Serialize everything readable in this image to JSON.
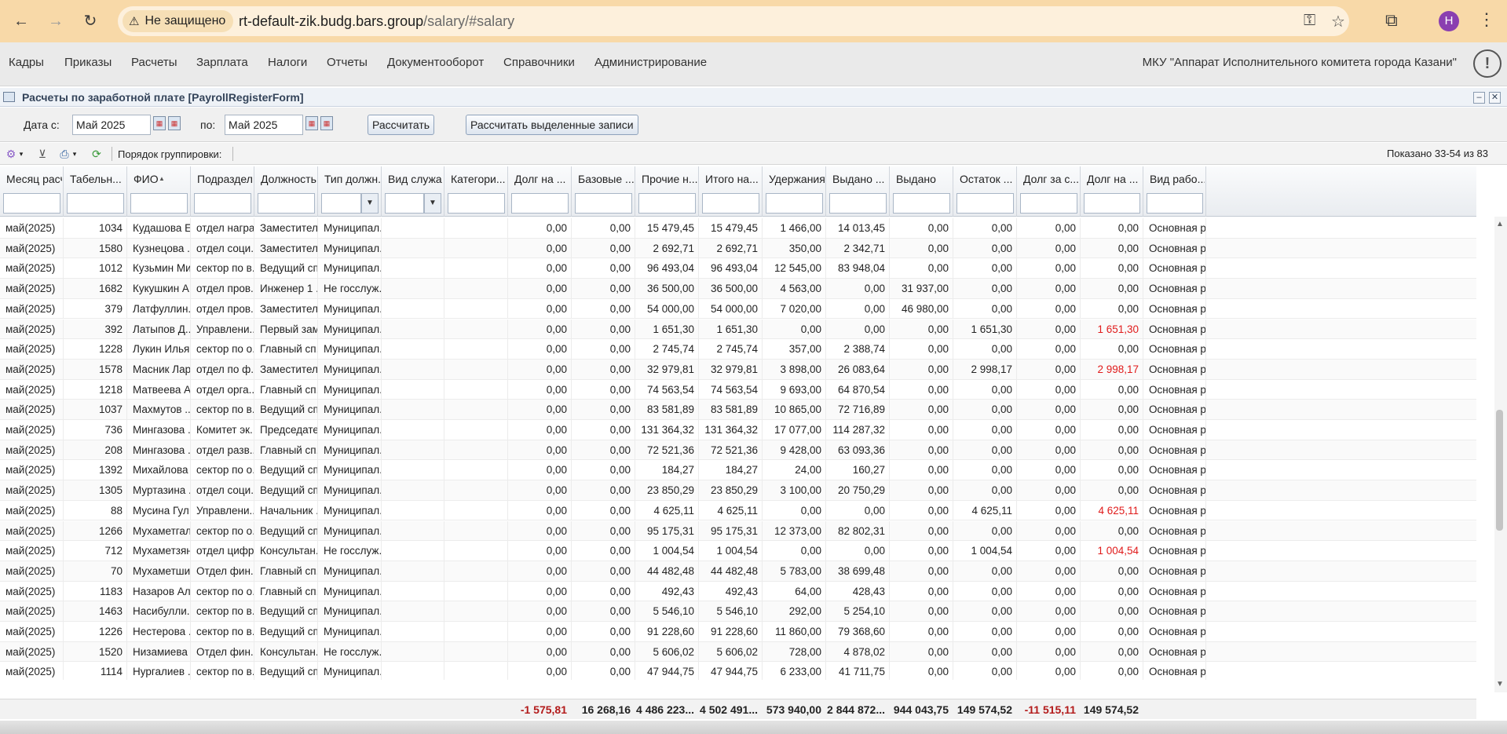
{
  "browser": {
    "not_secure_label": "Не защищено",
    "url_host": "rt-default-zik.budg.bars.group",
    "url_path": "/salary/#salary",
    "profile_initial": "Н"
  },
  "menu": {
    "items": [
      "Кадры",
      "Приказы",
      "Расчеты",
      "Зарплата",
      "Налоги",
      "Отчеты",
      "Документооборот",
      "Справочники",
      "Администрирование"
    ],
    "org": "МКУ \"Аппарат Исполнительного комитета города Казани\""
  },
  "form": {
    "title": "Расчеты по заработной плате [PayrollRegisterForm]",
    "date_from_label": "Дата с:",
    "date_from": "Май 2025",
    "date_to_label": "по:",
    "date_to": "Май 2025",
    "calc_button": "Рассчитать",
    "calc_selected_button": "Рассчитать выделенные записи"
  },
  "toolbar": {
    "group_label": "Порядок группировки:",
    "shown": "Показано 33-54 из 83"
  },
  "columns": [
    "Месяц расч...",
    "Табельн...",
    "ФИО",
    "Подразделе...",
    "Должность",
    "Тип должн...",
    "Вид служа...",
    "Категори...",
    "Долг на ...",
    "Базовые ...",
    "Прочие н...",
    "Итого на...",
    "Удержания",
    "Выдано ...",
    "Выдано",
    "Остаток ...",
    "Долг за с...",
    "Долг на ...",
    "Вид рабо..."
  ],
  "rows": [
    [
      "май(2025)",
      "1034",
      "Кудашова Е...",
      "отдел наград",
      "Заместител...",
      "Муниципал...",
      "",
      "",
      "0,00",
      "0,00",
      "15 479,45",
      "15 479,45",
      "1 466,00",
      "14 013,45",
      "0,00",
      "0,00",
      "0,00",
      "0,00",
      "Основная р..."
    ],
    [
      "май(2025)",
      "1580",
      "Кузнецова ...",
      "отдел соци...",
      "Заместител...",
      "Муниципал...",
      "",
      "",
      "0,00",
      "0,00",
      "2 692,71",
      "2 692,71",
      "350,00",
      "2 342,71",
      "0,00",
      "0,00",
      "0,00",
      "0,00",
      "Основная р..."
    ],
    [
      "май(2025)",
      "1012",
      "Кузьмин Ми...",
      "сектор по в...",
      "Ведущий сп...",
      "Муниципал...",
      "",
      "",
      "0,00",
      "0,00",
      "96 493,04",
      "96 493,04",
      "12 545,00",
      "83 948,04",
      "0,00",
      "0,00",
      "0,00",
      "0,00",
      "Основная р..."
    ],
    [
      "май(2025)",
      "1682",
      "Кукушкин А...",
      "отдел пров...",
      "Инженер 1 ...",
      "Не госслуж...",
      "",
      "",
      "0,00",
      "0,00",
      "36 500,00",
      "36 500,00",
      "4 563,00",
      "0,00",
      "31 937,00",
      "0,00",
      "0,00",
      "0,00",
      "Основная р..."
    ],
    [
      "май(2025)",
      "379",
      "Латфуллин...",
      "отдел пров...",
      "Заместител...",
      "Муниципал...",
      "",
      "",
      "0,00",
      "0,00",
      "54 000,00",
      "54 000,00",
      "7 020,00",
      "0,00",
      "46 980,00",
      "0,00",
      "0,00",
      "0,00",
      "Основная р..."
    ],
    [
      "май(2025)",
      "392",
      "Латыпов Д...",
      "Управлени...",
      "Первый зам...",
      "Муниципал...",
      "",
      "",
      "0,00",
      "0,00",
      "1 651,30",
      "1 651,30",
      "0,00",
      "0,00",
      "0,00",
      "1 651,30",
      "0,00",
      "1 651,30",
      "Основная р..."
    ],
    [
      "май(2025)",
      "1228",
      "Лукин Илья...",
      "сектор по о...",
      "Главный сп...",
      "Муниципал...",
      "",
      "",
      "0,00",
      "0,00",
      "2 745,74",
      "2 745,74",
      "357,00",
      "2 388,74",
      "0,00",
      "0,00",
      "0,00",
      "0,00",
      "Основная р..."
    ],
    [
      "май(2025)",
      "1578",
      "Масник Лар...",
      "отдел по ф...",
      "Заместител...",
      "Муниципал...",
      "",
      "",
      "0,00",
      "0,00",
      "32 979,81",
      "32 979,81",
      "3 898,00",
      "26 083,64",
      "0,00",
      "2 998,17",
      "0,00",
      "2 998,17",
      "Основная р..."
    ],
    [
      "май(2025)",
      "1218",
      "Матвеева А...",
      "отдел орга...",
      "Главный сп...",
      "Муниципал...",
      "",
      "",
      "0,00",
      "0,00",
      "74 563,54",
      "74 563,54",
      "9 693,00",
      "64 870,54",
      "0,00",
      "0,00",
      "0,00",
      "0,00",
      "Основная р..."
    ],
    [
      "май(2025)",
      "1037",
      "Махмутов ...",
      "сектор по в...",
      "Ведущий сп...",
      "Муниципал...",
      "",
      "",
      "0,00",
      "0,00",
      "83 581,89",
      "83 581,89",
      "10 865,00",
      "72 716,89",
      "0,00",
      "0,00",
      "0,00",
      "0,00",
      "Основная р..."
    ],
    [
      "май(2025)",
      "736",
      "Мингазова ...",
      "Комитет эк...",
      "Председате...",
      "Муниципал...",
      "",
      "",
      "0,00",
      "0,00",
      "131 364,32",
      "131 364,32",
      "17 077,00",
      "114 287,32",
      "0,00",
      "0,00",
      "0,00",
      "0,00",
      "Основная р..."
    ],
    [
      "май(2025)",
      "208",
      "Мингазова ...",
      "отдел разв...",
      "Главный сп...",
      "Муниципал...",
      "",
      "",
      "0,00",
      "0,00",
      "72 521,36",
      "72 521,36",
      "9 428,00",
      "63 093,36",
      "0,00",
      "0,00",
      "0,00",
      "0,00",
      "Основная р..."
    ],
    [
      "май(2025)",
      "1392",
      "Михайлова ...",
      "сектор по о...",
      "Ведущий сп...",
      "Муниципал...",
      "",
      "",
      "0,00",
      "0,00",
      "184,27",
      "184,27",
      "24,00",
      "160,27",
      "0,00",
      "0,00",
      "0,00",
      "0,00",
      "Основная р..."
    ],
    [
      "май(2025)",
      "1305",
      "Муртазина ...",
      "отдел соци...",
      "Ведущий сп...",
      "Муниципал...",
      "",
      "",
      "0,00",
      "0,00",
      "23 850,29",
      "23 850,29",
      "3 100,00",
      "20 750,29",
      "0,00",
      "0,00",
      "0,00",
      "0,00",
      "Основная р..."
    ],
    [
      "май(2025)",
      "88",
      "Мусина Гул...",
      "Управлени...",
      "Начальник ...",
      "Муниципал...",
      "",
      "",
      "0,00",
      "0,00",
      "4 625,11",
      "4 625,11",
      "0,00",
      "0,00",
      "0,00",
      "4 625,11",
      "0,00",
      "4 625,11",
      "Основная р..."
    ],
    [
      "май(2025)",
      "1266",
      "Мухаметгал...",
      "сектор по о...",
      "Ведущий сп...",
      "Муниципал...",
      "",
      "",
      "0,00",
      "0,00",
      "95 175,31",
      "95 175,31",
      "12 373,00",
      "82 802,31",
      "0,00",
      "0,00",
      "0,00",
      "0,00",
      "Основная р..."
    ],
    [
      "май(2025)",
      "712",
      "Мухаметзян...",
      "отдел цифр...",
      "Консультан...",
      "Не госслуж...",
      "",
      "",
      "0,00",
      "0,00",
      "1 004,54",
      "1 004,54",
      "0,00",
      "0,00",
      "0,00",
      "1 004,54",
      "0,00",
      "1 004,54",
      "Основная р..."
    ],
    [
      "май(2025)",
      "70",
      "Мухаметши...",
      "Отдел фин...",
      "Главный сп...",
      "Муниципал...",
      "",
      "",
      "0,00",
      "0,00",
      "44 482,48",
      "44 482,48",
      "5 783,00",
      "38 699,48",
      "0,00",
      "0,00",
      "0,00",
      "0,00",
      "Основная р..."
    ],
    [
      "май(2025)",
      "1183",
      "Назаров Ал...",
      "сектор по о...",
      "Главный сп...",
      "Муниципал...",
      "",
      "",
      "0,00",
      "0,00",
      "492,43",
      "492,43",
      "64,00",
      "428,43",
      "0,00",
      "0,00",
      "0,00",
      "0,00",
      "Основная р..."
    ],
    [
      "май(2025)",
      "1463",
      "Насибулли...",
      "сектор по в...",
      "Ведущий сп...",
      "Муниципал...",
      "",
      "",
      "0,00",
      "0,00",
      "5 546,10",
      "5 546,10",
      "292,00",
      "5 254,10",
      "0,00",
      "0,00",
      "0,00",
      "0,00",
      "Основная р..."
    ],
    [
      "май(2025)",
      "1226",
      "Нестерова ...",
      "сектор по в...",
      "Ведущий сп...",
      "Муниципал...",
      "",
      "",
      "0,00",
      "0,00",
      "91 228,60",
      "91 228,60",
      "11 860,00",
      "79 368,60",
      "0,00",
      "0,00",
      "0,00",
      "0,00",
      "Основная р..."
    ],
    [
      "май(2025)",
      "1520",
      "Низамиева ...",
      "Отдел фин...",
      "Консультан...",
      "Не госслуж...",
      "",
      "",
      "0,00",
      "0,00",
      "5 606,02",
      "5 606,02",
      "728,00",
      "4 878,02",
      "0,00",
      "0,00",
      "0,00",
      "0,00",
      "Основная р..."
    ],
    [
      "май(2025)",
      "1114",
      "Нургалиев ...",
      "сектор по в...",
      "Ведущий сп...",
      "Муниципал...",
      "",
      "",
      "0,00",
      "0,00",
      "47 944,75",
      "47 944,75",
      "6 233,00",
      "41 711,75",
      "0,00",
      "0,00",
      "0,00",
      "0,00",
      "Основная р..."
    ]
  ],
  "red_cells": [
    [
      5,
      17
    ],
    [
      7,
      17
    ],
    [
      14,
      17
    ],
    [
      16,
      17
    ]
  ],
  "summary": [
    "-1 575,81",
    "16 268,16",
    "4 486 223...",
    "4 502 491...",
    "573 940,00",
    "2 844 872...",
    "944 043,75",
    "149 574,52",
    "-11 515,11",
    "149 574,52"
  ],
  "colors": {
    "browser_bar": "#f8d9a8",
    "negative": "#e01b1b",
    "summary_negative": "#b31b1b"
  }
}
